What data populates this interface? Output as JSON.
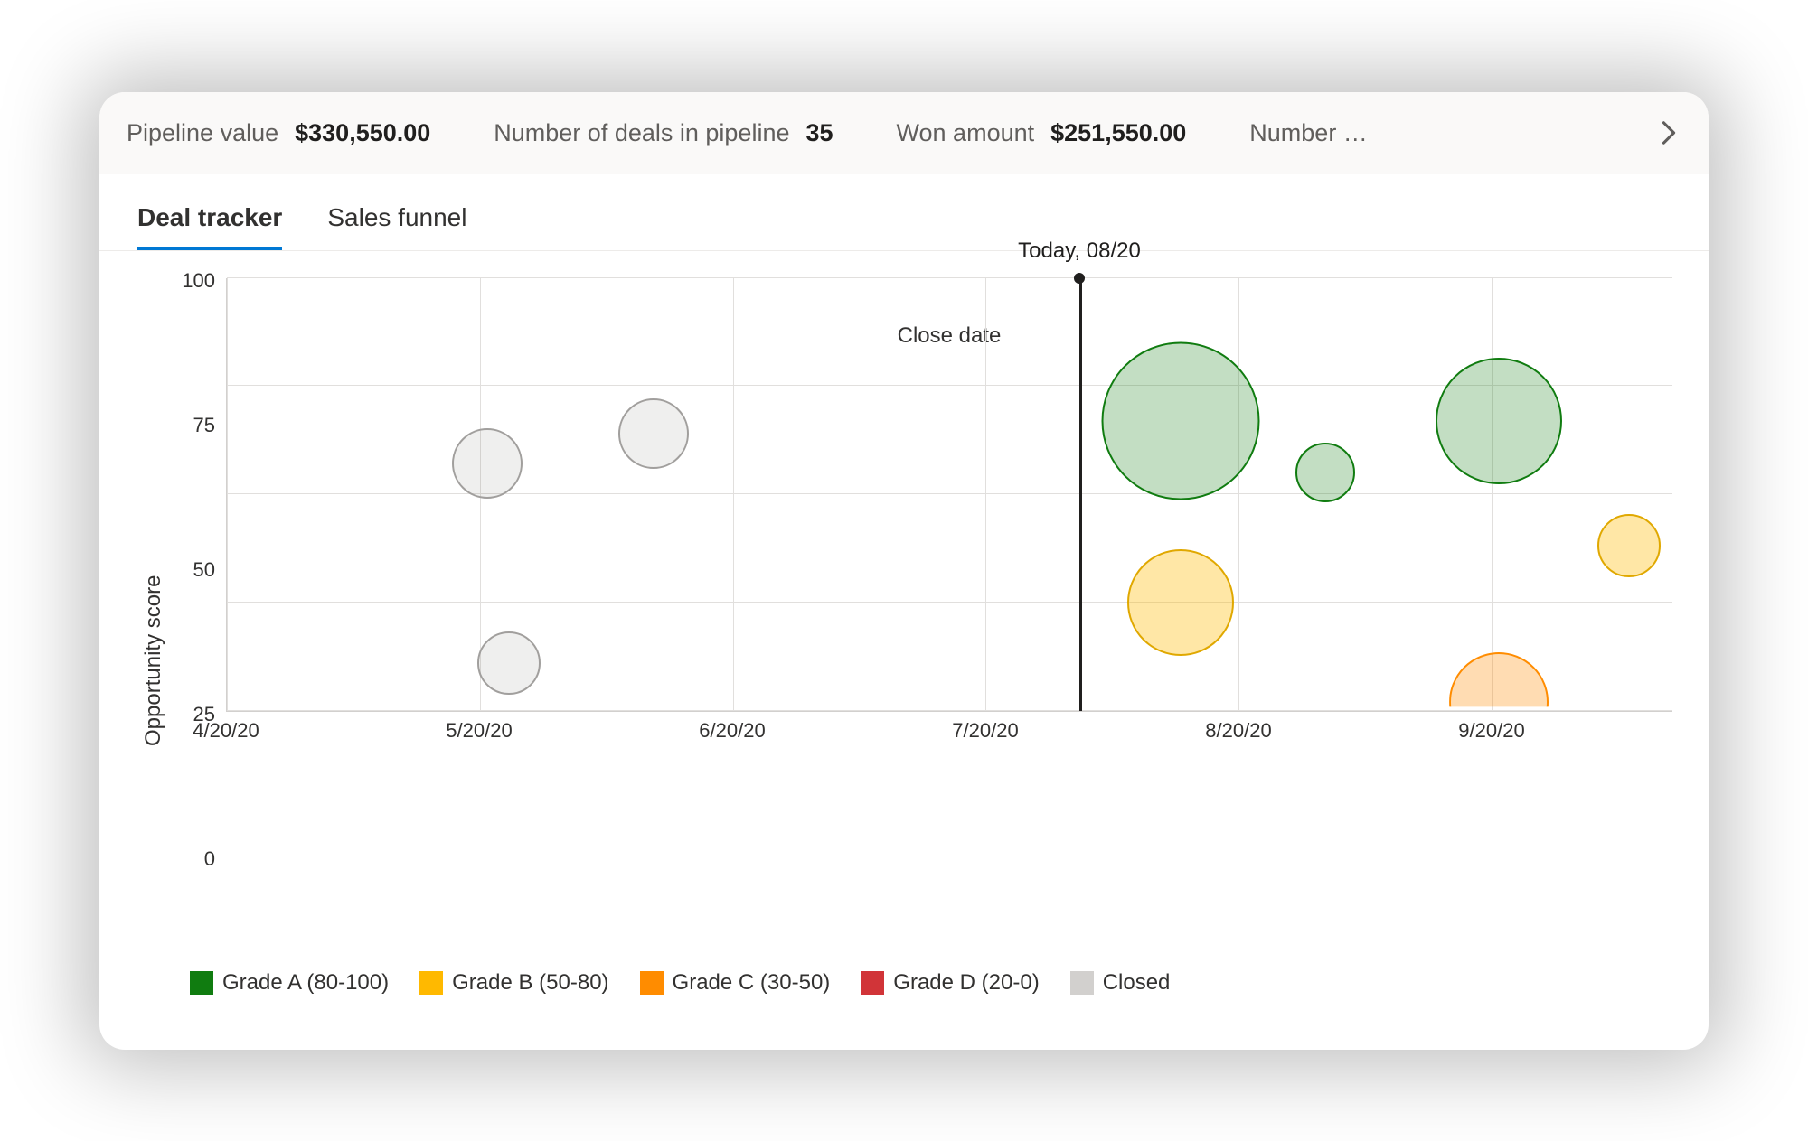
{
  "metrics": {
    "pipeline_value_label": "Pipeline value",
    "pipeline_value": "$330,550.00",
    "num_deals_label": "Number of deals in pipeline",
    "num_deals": "35",
    "won_amount_label": "Won amount",
    "won_amount": "$251,550.00",
    "next_truncated": "Number …"
  },
  "tabs": {
    "deal_tracker": "Deal tracker",
    "sales_funnel": "Sales funnel"
  },
  "chart": {
    "today_label": "Today, 08/20",
    "yaxis": "Opportunity score",
    "xaxis": "Close date",
    "yticks": [
      "100",
      "75",
      "50",
      "25",
      "0"
    ],
    "xticks": [
      "4/20/20",
      "5/20/20",
      "6/20/20",
      "7/20/20",
      "8/20/20",
      "9/20/20"
    ]
  },
  "legend": {
    "a": "Grade A (80-100)",
    "b": "Grade B (50-80)",
    "c": "Grade C (30-50)",
    "d": "Grade D (20-0)",
    "closed": "Closed"
  },
  "chart_data": {
    "type": "scatter",
    "title": "Deal tracker",
    "xlabel": "Close date",
    "ylabel": "Opportunity score",
    "ylim": [
      0,
      100
    ],
    "x_categories": [
      "4/20/20",
      "5/20/20",
      "6/20/20",
      "7/20/20",
      "8/20/20",
      "9/20/20"
    ],
    "today": "08/20/20",
    "legend": [
      {
        "name": "Grade A (80-100)",
        "color": "#107c10"
      },
      {
        "name": "Grade B (50-80)",
        "color": "#ffb900"
      },
      {
        "name": "Grade C (30-50)",
        "color": "#ff8c00"
      },
      {
        "name": "Grade D (20-0)",
        "color": "#d13438"
      },
      {
        "name": "Closed",
        "color": "#d2d0ce"
      }
    ],
    "points": [
      {
        "x": "5/20/20",
        "y": 57,
        "size": 40,
        "grade": "Closed"
      },
      {
        "x": "5/23/20",
        "y": 11,
        "size": 35,
        "grade": "Closed"
      },
      {
        "x": "6/10/20",
        "y": 64,
        "size": 40,
        "grade": "Closed"
      },
      {
        "x": "8/12/20",
        "y": 67,
        "size": 90,
        "grade": "Grade A"
      },
      {
        "x": "8/15/20",
        "y": 25,
        "size": 60,
        "grade": "Grade B"
      },
      {
        "x": "8/30/20",
        "y": 55,
        "size": 34,
        "grade": "Grade A"
      },
      {
        "x": "9/20/20",
        "y": 67,
        "size": 70,
        "grade": "Grade A"
      },
      {
        "x": "9/20/20",
        "y": 2,
        "size": 55,
        "grade": "Grade C"
      },
      {
        "x": "10/02/20",
        "y": 38,
        "size": 36,
        "grade": "Grade B"
      }
    ]
  }
}
